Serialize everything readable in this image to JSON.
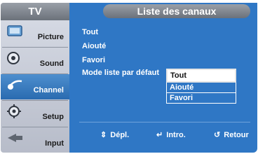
{
  "sidebar": {
    "title": "TV",
    "items": [
      {
        "label": "Picture",
        "icon": "picture-icon"
      },
      {
        "label": "Sound",
        "icon": "sound-icon"
      },
      {
        "label": "Channel",
        "icon": "channel-icon"
      },
      {
        "label": "Setup",
        "icon": "setup-icon"
      },
      {
        "label": "Input",
        "icon": "input-icon"
      }
    ],
    "selected": "Channel"
  },
  "header": {
    "title": "Liste des canaux"
  },
  "menu": {
    "items": [
      "Tout",
      "Aiouté",
      "Favori",
      "Mode liste par défaut"
    ],
    "colon": ":"
  },
  "dropdown": {
    "options": [
      "Tout",
      "Aiouté",
      "Favori"
    ],
    "selected": "Tout"
  },
  "footer": {
    "move_glyph": "⇕",
    "move_label": "Dépl.",
    "enter_glyph": "↵",
    "enter_label": "Intro.",
    "return_glyph": "↺",
    "return_label": "Retour"
  },
  "colors": {
    "panel": "#2f77c5",
    "selected_sidebar": "#3e80c4",
    "text": "#ffffff"
  }
}
